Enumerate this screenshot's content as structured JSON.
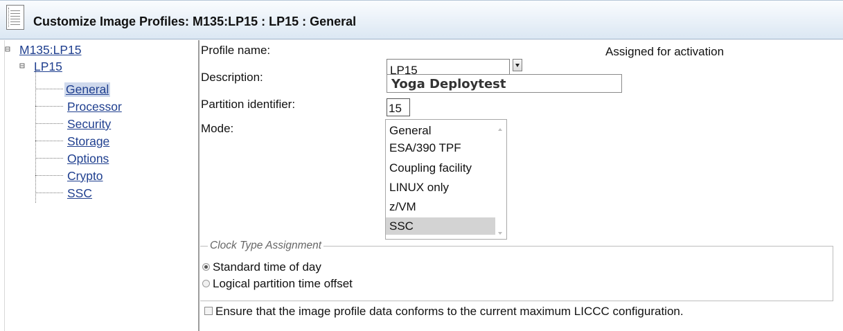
{
  "window": {
    "title": "Customize Image Profiles: M135:LP15 : LP15 : General",
    "icon": "notebook-icon"
  },
  "tree": {
    "root": {
      "label": "M135:LP15",
      "toggle": "⊟"
    },
    "child": {
      "label": "LP15",
      "toggle": "⊟"
    },
    "items": [
      {
        "label": "General",
        "selected": true
      },
      {
        "label": "Processor"
      },
      {
        "label": "Security"
      },
      {
        "label": "Storage"
      },
      {
        "label": "Options"
      },
      {
        "label": "Crypto"
      },
      {
        "label": "SSC"
      }
    ]
  },
  "form": {
    "profile_name_label": "Profile name:",
    "profile_name_value": "LP15",
    "status_text": "Assigned for activation",
    "description_label": "Description:",
    "description_value": "Yoga Deploytest",
    "partition_id_label": "Partition identifier:",
    "partition_id_value": "15",
    "mode_label": "Mode:",
    "mode_options": [
      "General",
      "ESA/390 TPF",
      "Coupling facility",
      "LINUX only",
      "z/VM",
      "SSC"
    ],
    "mode_selected": "SSC",
    "clock_group_label": "Clock Type Assignment",
    "clock_options": [
      {
        "label": "Standard time of day",
        "checked": true
      },
      {
        "label": "Logical partition time offset",
        "checked": false
      }
    ],
    "conform_checkbox_label": "Ensure that the image profile data conforms to the current maximum LICCC configuration.",
    "conform_checked": false
  }
}
